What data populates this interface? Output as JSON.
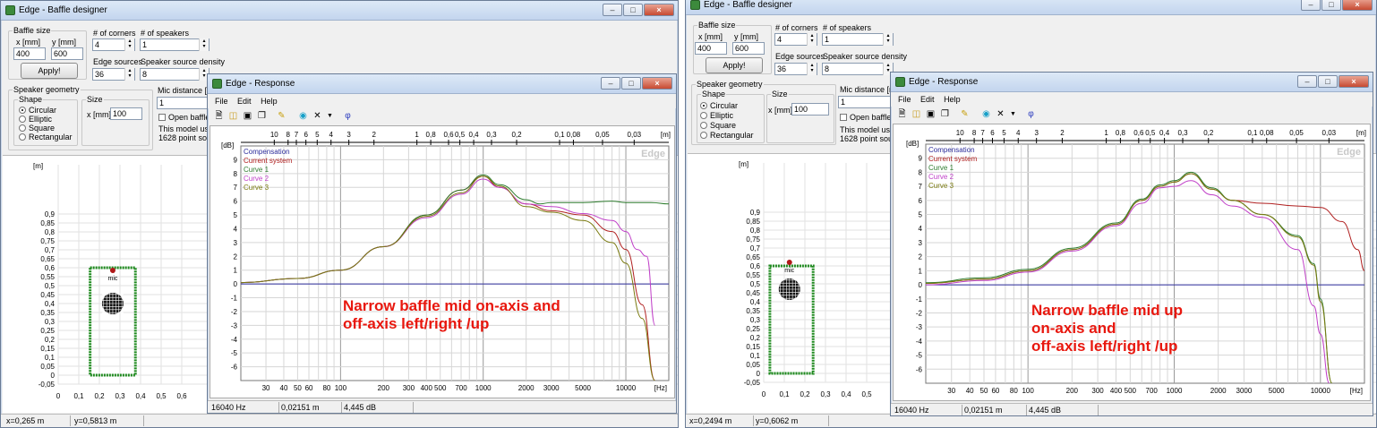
{
  "left": {
    "designer": {
      "title": "Edge - Baffle designer",
      "baffle_size": {
        "label": "Baffle size",
        "x_label": "x [mm]",
        "y_label": "y [mm]",
        "x": "400",
        "y": "600",
        "apply": "Apply!"
      },
      "corners": {
        "label": "# of corners",
        "value": "4"
      },
      "speakers": {
        "label": "# of speakers",
        "value": "1"
      },
      "edge_sources": {
        "label": "Edge sources",
        "value": "36"
      },
      "density": {
        "label": "Speaker source density",
        "value": "8"
      },
      "geometry": {
        "label": "Speaker geometry",
        "shape_label": "Shape",
        "shapes": [
          "Circular",
          "Elliptic",
          "Square",
          "Rectangular"
        ],
        "selected": "Circular",
        "size_label": "Size",
        "size_x_label": "x [mm]",
        "size_x": "100"
      },
      "mic": {
        "label": "Mic distance [m",
        "value": "1",
        "open_baffle": "Open baffle",
        "note1": "This model use",
        "note2": "1628 point sour"
      },
      "plot": {
        "unit": "[m]",
        "y_ticks": [
          "0,9",
          "0,85",
          "0,8",
          "0,75",
          "0,7",
          "0,65",
          "0,6",
          "0,55",
          "0,5",
          "0,45",
          "0,4",
          "0,35",
          "0,3",
          "0,25",
          "0,2",
          "0,15",
          "0,1",
          "0,05",
          "0",
          "-0,05"
        ],
        "x_ticks": [
          "0",
          "0,1",
          "0,2",
          "0,3",
          "0,4",
          "0,5",
          "0,6"
        ],
        "mic_label": "mic"
      },
      "status": {
        "x": "x=0,265 m",
        "y": "y=0,5813 m"
      }
    },
    "response": {
      "title": "Edge - Response",
      "menu": [
        "File",
        "Edit",
        "Help"
      ],
      "status": [
        "16040 Hz",
        "0,02151 m",
        "4,445 dB"
      ],
      "overlay": "Narrow baffle mid on-axis and\noff-axis left/right /up"
    }
  },
  "right": {
    "designer": {
      "title": "Edge - Baffle designer",
      "baffle_size": {
        "label": "Baffle size",
        "x_label": "x [mm]",
        "y_label": "y [mm]",
        "x": "400",
        "y": "600",
        "apply": "Apply!"
      },
      "corners": {
        "label": "# of corners",
        "value": "4"
      },
      "speakers": {
        "label": "# of speakers",
        "value": "1"
      },
      "edge_sources": {
        "label": "Edge sources",
        "value": "36"
      },
      "density": {
        "label": "Speaker source density",
        "value": "8"
      },
      "geometry": {
        "label": "Speaker geometry",
        "shape_label": "Shape",
        "shapes": [
          "Circular",
          "Elliptic",
          "Square",
          "Rectangular"
        ],
        "selected": "Circular",
        "size_label": "Size",
        "size_x_label": "x [mm]",
        "size_x": "100"
      },
      "mic": {
        "label": "Mic distance [m",
        "value": "1",
        "open_baffle": "Open baffle",
        "note1": "This model use",
        "note2": "1628 point sour"
      },
      "plot": {
        "unit": "[m]",
        "y_ticks": [
          "0,9",
          "0,85",
          "0,8",
          "0,75",
          "0,7",
          "0,65",
          "0,6",
          "0,55",
          "0,5",
          "0,45",
          "0,4",
          "0,35",
          "0,3",
          "0,25",
          "0,2",
          "0,15",
          "0,1",
          "0,05",
          "0",
          "-0,05"
        ],
        "x_ticks": [
          "0",
          "0,1",
          "0,2",
          "0,3",
          "0,4",
          "0,5"
        ],
        "mic_label": "mic"
      },
      "status": {
        "x": "x=0,2494 m",
        "y": "y=0,6062 m"
      }
    },
    "response": {
      "title": "Edge - Response",
      "menu": [
        "File",
        "Edit",
        "Help"
      ],
      "status": [
        "16040 Hz",
        "0,02151 m",
        "4,445 dB"
      ],
      "overlay": "Narrow baffle mid up\non-axis and\noff-axis left/right /up"
    }
  },
  "chart_data": [
    {
      "type": "line",
      "watermark": "Edge",
      "x_scale": "log",
      "xlim": [
        20,
        20000
      ],
      "ylim": [
        -7,
        10
      ],
      "ylabel": "[dB]",
      "xlabel": "[Hz]",
      "y_ticks": [
        -6,
        -5,
        -4,
        -3,
        -2,
        -1,
        0,
        1,
        2,
        3,
        4,
        5,
        6,
        7,
        8,
        9
      ],
      "x_ticks": [
        30,
        40,
        50,
        60,
        80,
        100,
        200,
        300,
        400,
        500,
        700,
        1000,
        2000,
        3000,
        5000,
        10000
      ],
      "top_unit": "[m]",
      "top_ticks": [
        "10",
        "8",
        "7",
        "6",
        "5",
        "4",
        "3",
        "2",
        "1",
        "0,8",
        "0,6",
        "0,5",
        "0,4",
        "0,3",
        "0,2",
        "0,1",
        "0,08",
        "0,05",
        "0,03"
      ],
      "legend": [
        "Compensation",
        "Current system",
        "Curve 1",
        "Curve 2",
        "Curve 3"
      ],
      "colors": {
        "Compensation": "#2b2b9a",
        "Current system": "#b02020",
        "Curve 1": "#2f7d2f",
        "Curve 2": "#c040c8",
        "Curve 3": "#7a7a10"
      },
      "series": [
        {
          "name": "Compensation",
          "x": [
            20,
            30,
            50,
            100,
            200,
            500,
            1000,
            2000,
            5000,
            10000,
            20000
          ],
          "y": [
            0,
            0,
            0,
            0,
            0,
            0,
            0,
            0,
            0,
            0,
            0
          ]
        },
        {
          "name": "Current system",
          "x": [
            20,
            50,
            100,
            200,
            400,
            700,
            1000,
            1300,
            2000,
            3000,
            5000,
            8000,
            10000,
            13000,
            16000
          ],
          "y": [
            0.1,
            0.4,
            1.0,
            2.7,
            5.0,
            6.8,
            7.8,
            7.0,
            5.8,
            5.3,
            5.0,
            3.8,
            2.5,
            -1.5,
            -7
          ]
        },
        {
          "name": "Curve 1",
          "x": [
            20,
            50,
            100,
            200,
            400,
            700,
            1000,
            1300,
            2000,
            2500,
            3000,
            5000,
            8000,
            10000,
            15000,
            20000
          ],
          "y": [
            0.1,
            0.4,
            1.0,
            2.7,
            5.0,
            6.8,
            7.9,
            7.2,
            6.1,
            5.8,
            5.9,
            5.9,
            6.0,
            5.9,
            5.9,
            5.8
          ]
        },
        {
          "name": "Curve 2",
          "x": [
            20,
            50,
            100,
            200,
            400,
            700,
            1000,
            1300,
            2000,
            3000,
            5000,
            8000,
            10000,
            12000,
            14000,
            16000
          ],
          "y": [
            0.1,
            0.4,
            1.0,
            2.7,
            4.8,
            6.5,
            7.6,
            7.0,
            5.8,
            5.6,
            5.1,
            4.6,
            3.8,
            2.5,
            2.0,
            -3
          ]
        },
        {
          "name": "Curve 3",
          "x": [
            20,
            50,
            100,
            200,
            400,
            700,
            1000,
            1300,
            2000,
            3000,
            5000,
            8000,
            10000,
            13000,
            16000
          ],
          "y": [
            0.1,
            0.4,
            1.0,
            2.7,
            4.9,
            6.6,
            7.8,
            7.1,
            5.6,
            5.2,
            4.6,
            3.0,
            1.5,
            -2.5,
            -7
          ]
        }
      ]
    },
    {
      "type": "line",
      "watermark": "Edge",
      "x_scale": "log",
      "xlim": [
        20,
        20000
      ],
      "ylim": [
        -7,
        10
      ],
      "ylabel": "[dB]",
      "xlabel": "[Hz]",
      "y_ticks": [
        -6,
        -5,
        -4,
        -3,
        -2,
        -1,
        0,
        1,
        2,
        3,
        4,
        5,
        6,
        7,
        8,
        9
      ],
      "x_ticks": [
        30,
        40,
        50,
        60,
        80,
        100,
        200,
        300,
        400,
        500,
        700,
        1000,
        2000,
        3000,
        5000,
        10000
      ],
      "top_unit": "[m]",
      "top_ticks": [
        "10",
        "8",
        "7",
        "6",
        "5",
        "4",
        "3",
        "2",
        "1",
        "0,8",
        "0,6",
        "0,5",
        "0,4",
        "0,3",
        "0,2",
        "0,1",
        "0,08",
        "0,05",
        "0,03"
      ],
      "legend": [
        "Compensation",
        "Current system",
        "Curve 1",
        "Curve 2",
        "Curve 3"
      ],
      "colors": {
        "Compensation": "#2b2b9a",
        "Current system": "#b02020",
        "Curve 1": "#2f7d2f",
        "Curve 2": "#c040c8",
        "Curve 3": "#7a7a10"
      },
      "series": [
        {
          "name": "Compensation",
          "x": [
            20,
            30,
            50,
            100,
            200,
            500,
            1000,
            2000,
            5000,
            10000,
            20000
          ],
          "y": [
            0,
            0,
            0,
            0,
            0,
            0,
            0,
            0,
            0,
            0,
            0
          ]
        },
        {
          "name": "Current system",
          "x": [
            20,
            50,
            100,
            200,
            400,
            600,
            800,
            1000,
            1300,
            1800,
            2500,
            4000,
            7000,
            10000,
            14000,
            18000,
            20000
          ],
          "y": [
            0.1,
            0.4,
            1.0,
            2.5,
            4.3,
            6.0,
            7.0,
            7.3,
            7.9,
            6.8,
            6.0,
            5.8,
            5.6,
            5.5,
            4.5,
            2.5,
            1.0
          ]
        },
        {
          "name": "Curve 1",
          "x": [
            20,
            50,
            100,
            200,
            400,
            600,
            800,
            1000,
            1300,
            1800,
            2500,
            4000,
            7000,
            9000,
            10000,
            12000
          ],
          "y": [
            0.15,
            0.5,
            1.1,
            2.6,
            4.4,
            6.1,
            7.1,
            7.4,
            8.0,
            6.9,
            6.0,
            5.0,
            3.5,
            1.5,
            -1.0,
            -7
          ]
        },
        {
          "name": "Curve 2",
          "x": [
            20,
            50,
            100,
            200,
            400,
            600,
            800,
            1000,
            1300,
            1800,
            2500,
            4000,
            7000,
            9000,
            10000,
            11500
          ],
          "y": [
            0,
            0.3,
            0.9,
            2.4,
            4.2,
            5.8,
            6.9,
            7.0,
            7.4,
            6.4,
            5.6,
            4.8,
            2.5,
            -1.5,
            -3.5,
            -7
          ]
        },
        {
          "name": "Curve 3",
          "x": [
            20,
            50,
            100,
            200,
            400,
            600,
            800,
            1000,
            1300,
            1800,
            2500,
            4000,
            7000,
            9000,
            10000,
            12000
          ],
          "y": [
            0.1,
            0.4,
            1.0,
            2.5,
            4.3,
            6.0,
            7.0,
            7.3,
            7.9,
            6.8,
            6.0,
            5.0,
            3.4,
            1.4,
            -1.2,
            -7
          ]
        }
      ]
    }
  ]
}
